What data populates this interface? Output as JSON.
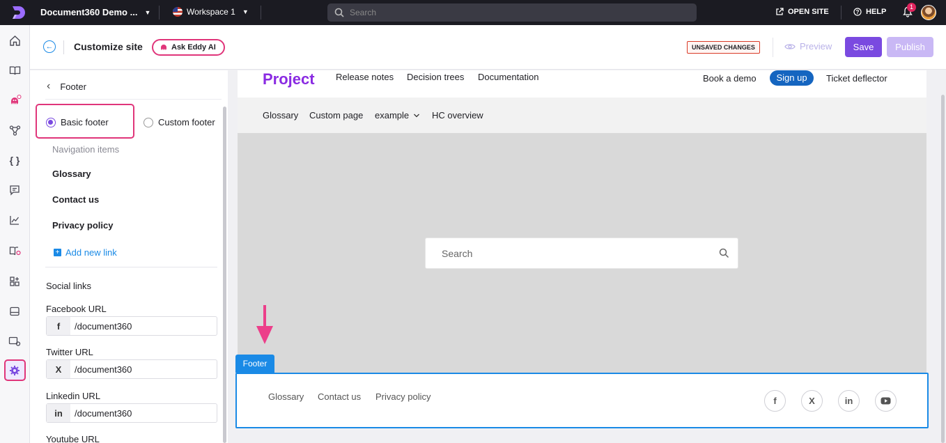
{
  "topbar": {
    "project_name": "Document360 Demo ...",
    "workspace": "Workspace 1",
    "search_placeholder": "Search",
    "open_site": "OPEN SITE",
    "help": "HELP",
    "notification_count": "1"
  },
  "subheader": {
    "title": "Customize site",
    "eddy": "Ask Eddy AI",
    "unsaved": "UNSAVED CHANGES",
    "preview": "Preview",
    "save": "Save",
    "publish": "Publish"
  },
  "panel": {
    "heading": "Footer",
    "basic_footer": "Basic footer",
    "custom_footer": "Custom footer",
    "nav_items_label": "Navigation items",
    "nav_items": [
      "Glossary",
      "Contact us",
      "Privacy policy"
    ],
    "add_link": "Add new link",
    "social_links": "Social links",
    "fields": [
      {
        "label": "Facebook URL",
        "icon": "f",
        "value": "/document360"
      },
      {
        "label": "Twitter URL",
        "icon": "X",
        "value": "/document360"
      },
      {
        "label": "Linkedin URL",
        "icon": "in",
        "value": "/document360"
      }
    ],
    "youtube_label": "Youtube URL"
  },
  "site": {
    "brand": "Project",
    "nav": [
      "Release notes",
      "Decision trees",
      "Documentation"
    ],
    "book_demo": "Book a demo",
    "sign_up": "Sign up",
    "ticket": "Ticket deflector",
    "subnav": [
      "Glossary",
      "Custom page",
      "example",
      "HC overview"
    ],
    "search_placeholder": "Search",
    "footer_tag": "Footer",
    "footer_links": [
      "Glossary",
      "Contact us",
      "Privacy policy"
    ],
    "social_icons": [
      "f",
      "X",
      "in",
      "yt"
    ]
  },
  "colors": {
    "accent": "#7a4ae0",
    "highlight": "#e0357a",
    "link": "#1a8ae6",
    "brand": "#8a2be2"
  }
}
